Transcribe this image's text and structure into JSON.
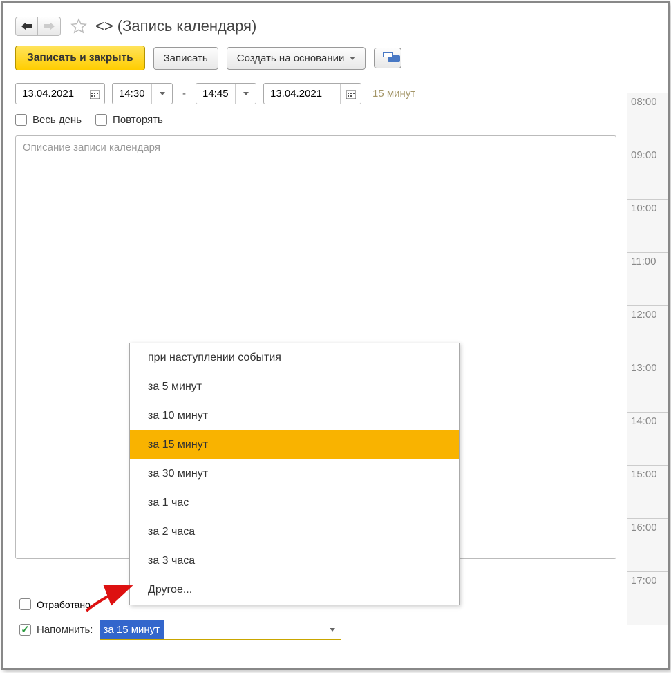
{
  "header": {
    "title": "<> (Запись календаря)"
  },
  "toolbar": {
    "save_close": "Записать и закрыть",
    "save": "Записать",
    "create_based": "Создать на основании"
  },
  "datetime": {
    "start_date": "13.04.2021",
    "start_time": "14:30",
    "end_time": "14:45",
    "end_date": "13.04.2021",
    "duration": "15 минут"
  },
  "checkboxes": {
    "all_day": "Весь день",
    "repeat": "Повторять",
    "done": "Отработано",
    "remind": "Напомнить:"
  },
  "description_placeholder": "Описание записи календаря",
  "reminder": {
    "value": "за 15 минут",
    "options": [
      "при наступлении события",
      "за 5 минут",
      "за 10 минут",
      "за 15 минут",
      "за 30 минут",
      "за 1 час",
      "за 2 часа",
      "за 3 часа",
      "Другое..."
    ]
  },
  "timeline": [
    "08:00",
    "09:00",
    "10:00",
    "11:00",
    "12:00",
    "13:00",
    "14:00",
    "15:00",
    "16:00",
    "17:00"
  ]
}
